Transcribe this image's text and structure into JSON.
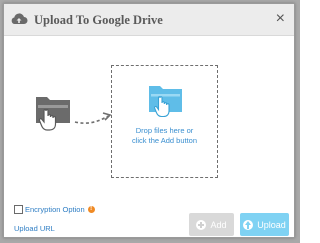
{
  "dialog": {
    "title": "Upload To Google Drive",
    "title_icon": "cloud-upload-icon",
    "close_label": "×"
  },
  "dropzone": {
    "line1": "Drop files here or",
    "line2": "click the Add button",
    "icon": "folder-hand-icon"
  },
  "illustration": {
    "icon": "folder-hand-icon",
    "arrow": "dashed-arrow-icon"
  },
  "encryption": {
    "label": "Encryption Option",
    "checked": false,
    "info_icon": "info-icon"
  },
  "upload_url": {
    "label": "Upload URL"
  },
  "buttons": {
    "add_label": "Add",
    "upload_label": "Upload"
  },
  "colors": {
    "accent": "#7fd2f3",
    "link": "#2f7ec4",
    "drop_icon": "#5fbde8",
    "info": "#f08a24",
    "disabled": "#d9d9d9"
  }
}
